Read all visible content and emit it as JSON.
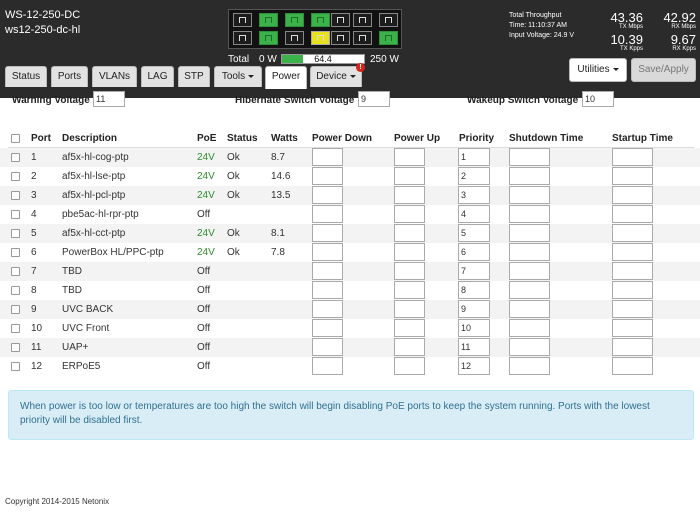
{
  "device": {
    "model": "WS-12-250-DC",
    "name": "ws12-250-dc-hl"
  },
  "power_summary": {
    "total_label": "Total",
    "min": "0 W",
    "current": "64.4",
    "max": "250 W",
    "fill_fraction": 0.26
  },
  "port_panel": {
    "top": [
      "dark",
      "green",
      "green",
      "green",
      "dark",
      "dark",
      "dark"
    ],
    "bottom": [
      "dark",
      "green",
      "dark",
      "yellow",
      "dark",
      "dark",
      "green"
    ]
  },
  "throughput": {
    "title": "Total Throughput",
    "time": "Time: 11:10:37 AM",
    "voltage": "Input Voltage: 24.9 V",
    "tx_mbps": "43.36",
    "tx_mbps_unit": "TX Mbps",
    "rx_mbps": "42.92",
    "rx_mbps_unit": "RX Mbps",
    "tx_kpps": "10.39",
    "tx_kpps_unit": "TX Kpps",
    "rx_kpps": "9.67",
    "rx_kpps_unit": "RX Kpps"
  },
  "tabs": [
    {
      "label": "Status"
    },
    {
      "label": "Ports"
    },
    {
      "label": "VLANs"
    },
    {
      "label": "LAG"
    },
    {
      "label": "STP"
    },
    {
      "label": "Tools"
    },
    {
      "label": "Power"
    },
    {
      "label": "Device"
    }
  ],
  "device_badge": "!",
  "buttons": {
    "utilities": "Utilities",
    "save_apply": "Save/Apply"
  },
  "voltages": {
    "warning_label": "Warning Voltage",
    "warning_value": "11",
    "hibernate_label": "Hibernate Switch Voltage",
    "hibernate_value": "9",
    "wakeup_label": "Wakeup Switch Voltage",
    "wakeup_value": "10"
  },
  "table": {
    "headers": {
      "port": "Port",
      "description": "Description",
      "poe": "PoE",
      "status": "Status",
      "watts": "Watts",
      "power_down": "Power Down",
      "power_up": "Power Up",
      "priority": "Priority",
      "shutdown_time": "Shutdown Time",
      "startup_time": "Startup Time"
    },
    "rows": [
      {
        "port": "1",
        "description": "af5x-hl-cog-ptp",
        "poe": "24V",
        "status": "Ok",
        "watts": "8.7",
        "priority": "1"
      },
      {
        "port": "2",
        "description": "af5x-hl-lse-ptp",
        "poe": "24V",
        "status": "Ok",
        "watts": "14.6",
        "priority": "2"
      },
      {
        "port": "3",
        "description": "af5x-hl-pcl-ptp",
        "poe": "24V",
        "status": "Ok",
        "watts": "13.5",
        "priority": "3"
      },
      {
        "port": "4",
        "description": "pbe5ac-hl-rpr-ptp",
        "poe": "Off",
        "status": "",
        "watts": "",
        "priority": "4"
      },
      {
        "port": "5",
        "description": "af5x-hl-cct-ptp",
        "poe": "24V",
        "status": "Ok",
        "watts": "8.1",
        "priority": "5"
      },
      {
        "port": "6",
        "description": "PowerBox HL/PPC-ptp",
        "poe": "24V",
        "status": "Ok",
        "watts": "7.8",
        "priority": "6"
      },
      {
        "port": "7",
        "description": "TBD",
        "poe": "Off",
        "status": "",
        "watts": "",
        "priority": "7"
      },
      {
        "port": "8",
        "description": "TBD",
        "poe": "Off",
        "status": "",
        "watts": "",
        "priority": "8"
      },
      {
        "port": "9",
        "description": "UVC BACK",
        "poe": "Off",
        "status": "",
        "watts": "",
        "priority": "9"
      },
      {
        "port": "10",
        "description": "UVC Front",
        "poe": "Off",
        "status": "",
        "watts": "",
        "priority": "10"
      },
      {
        "port": "11",
        "description": "UAP+",
        "poe": "Off",
        "status": "",
        "watts": "",
        "priority": "11"
      },
      {
        "port": "12",
        "description": "ERPoE5",
        "poe": "Off",
        "status": "",
        "watts": "",
        "priority": "12"
      }
    ]
  },
  "alert": "When power is too low or temperatures are too high the switch will begin disabling PoE ports to keep the system running. Ports with the lowest priority will be disabled first.",
  "footer": "Copyright 2014-2015 Netonix"
}
